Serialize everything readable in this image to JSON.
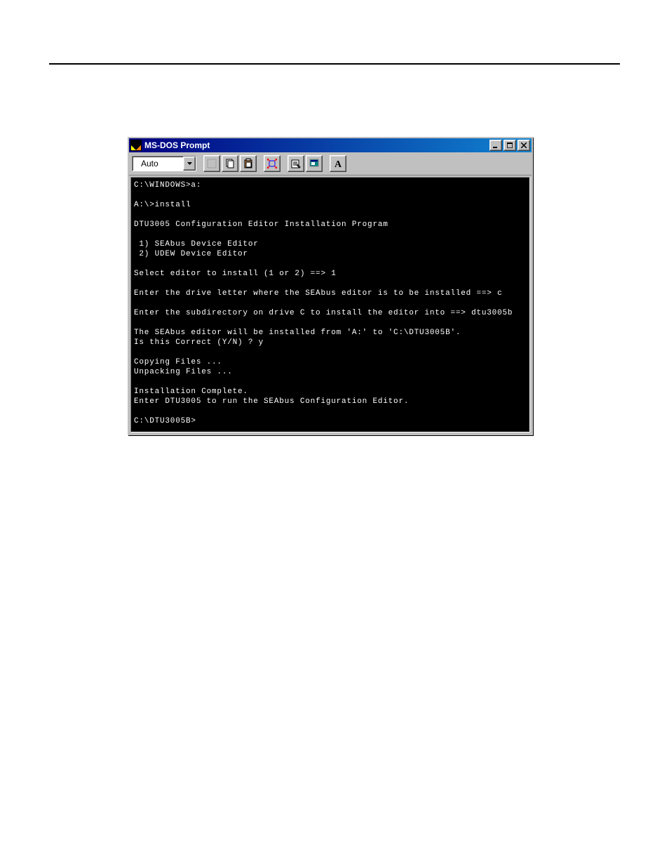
{
  "window": {
    "title": "MS-DOS Prompt"
  },
  "toolbar": {
    "combo_value": "Auto",
    "buttons": [
      {
        "name": "mark-icon"
      },
      {
        "name": "copy-icon"
      },
      {
        "name": "paste-icon"
      },
      {
        "name": "fullscreen-icon"
      },
      {
        "name": "properties-icon"
      },
      {
        "name": "background-icon"
      },
      {
        "name": "font-icon"
      }
    ]
  },
  "console_text": "C:\\WINDOWS>a:\n\nA:\\>install\n\nDTU3005 Configuration Editor Installation Program\n\n 1) SEAbus Device Editor\n 2) UDEW Device Editor\n\nSelect editor to install (1 or 2) ==> 1\n\nEnter the drive letter where the SEAbus editor is to be installed ==> c\n\nEnter the subdirectory on drive C to install the editor into ==> dtu3005b\n\nThe SEAbus editor will be installed from 'A:' to 'C:\\DTU3005B'.\nIs this Correct (Y/N) ? y\n\nCopying Files ...\nUnpacking Files ...\n\nInstallation Complete.\nEnter DTU3005 to run the SEAbus Configuration Editor.\n\nC:\\DTU3005B>"
}
